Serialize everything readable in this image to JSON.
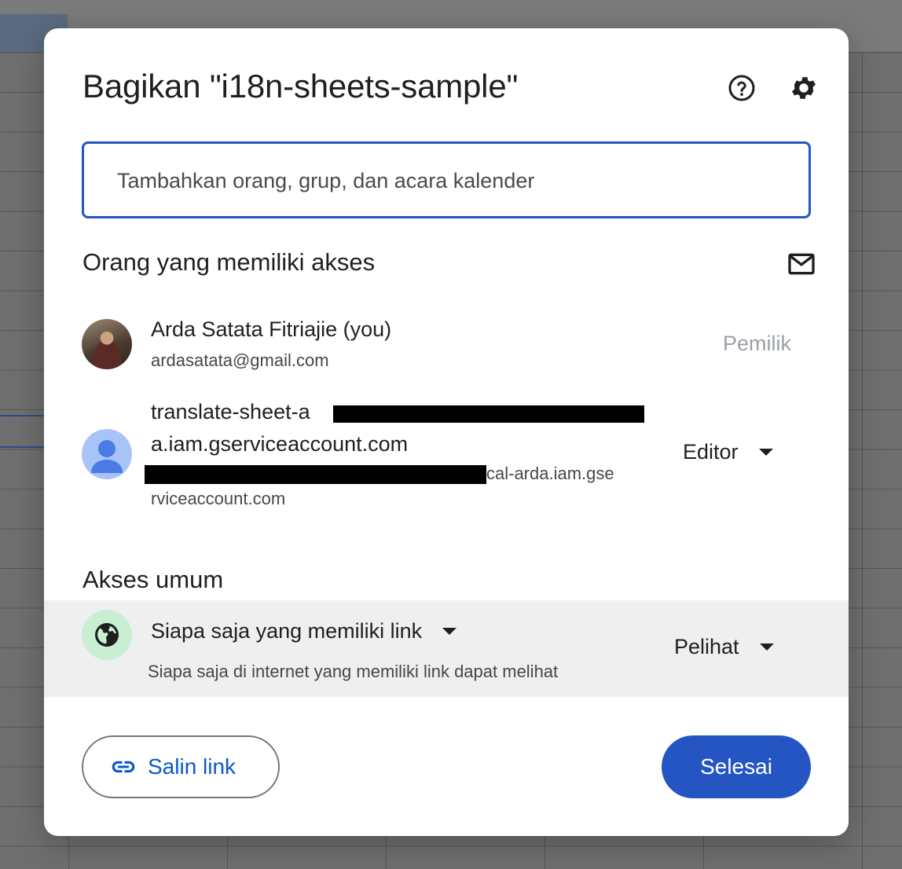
{
  "dialog": {
    "title": "Bagikan \"i18n-sheets-sample\"",
    "help_icon": "help-circle-icon",
    "settings_icon": "gear-icon"
  },
  "search": {
    "placeholder": "Tambahkan orang, grup, dan acara kalender"
  },
  "people": {
    "heading": "Orang yang memiliki akses",
    "mail_icon": "mail-icon",
    "list": [
      {
        "name": "Arda Satata Fitriajie (you)",
        "email": "ardasatata@gmail.com",
        "role": "Pemilik"
      },
      {
        "name_line1": "translate-sheet-a",
        "name_line2": "a.iam.gserviceaccount.com",
        "email_line1": "cal-arda.iam.gse",
        "email_line2": "rviceaccount.com",
        "role": "Editor"
      }
    ]
  },
  "general_access": {
    "heading": "Akses umum",
    "scope": "Siapa saja yang memiliki link",
    "description": "Siapa saja di internet yang memiliki link dapat melihat",
    "role": "Pelihat"
  },
  "footer": {
    "copy_link": "Salin link",
    "done": "Selesai"
  },
  "colors": {
    "accent": "#2455c3",
    "link_text": "#0b57d0",
    "general_bg": "#efefef",
    "globe_bg": "#c9efd2"
  }
}
